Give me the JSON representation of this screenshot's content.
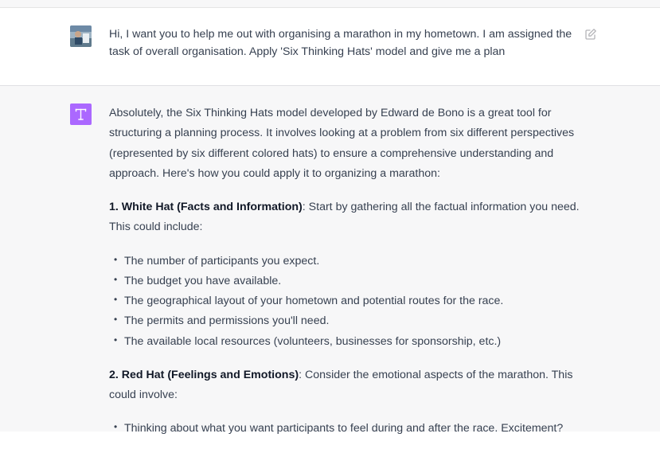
{
  "user_message": {
    "text": "Hi, I want you to help me out with organising a marathon in my hometown. I am assigned the task of overall organisation. Apply 'Six Thinking Hats' model and give me a plan",
    "avatar_icon": "user-photo-avatar",
    "edit_icon": "pencil-square-icon"
  },
  "assistant": {
    "avatar_icon": "assistant-logo",
    "avatar_color": "#ab68ff",
    "intro": "Absolutely, the Six Thinking Hats model developed by Edward de Bono is a great tool for structuring a planning process. It involves looking at a problem from six different perspectives (represented by six different colored hats) to ensure a comprehensive understanding and approach. Here's how you could apply it to organizing a marathon:",
    "sections": [
      {
        "heading": "1. White Hat (Facts and Information)",
        "text": ": Start by gathering all the factual information you need. This could include:",
        "items": [
          "The number of participants you expect.",
          "The budget you have available.",
          "The geographical layout of your hometown and potential routes for the race.",
          "The permits and permissions you'll need.",
          "The available local resources (volunteers, businesses for sponsorship, etc.)"
        ]
      },
      {
        "heading": "2. Red Hat (Feelings and Emotions)",
        "text": ": Consider the emotional aspects of the marathon. This could involve:",
        "items": [
          "Thinking about what you want participants to feel during and after the race. Excitement?"
        ]
      }
    ]
  }
}
